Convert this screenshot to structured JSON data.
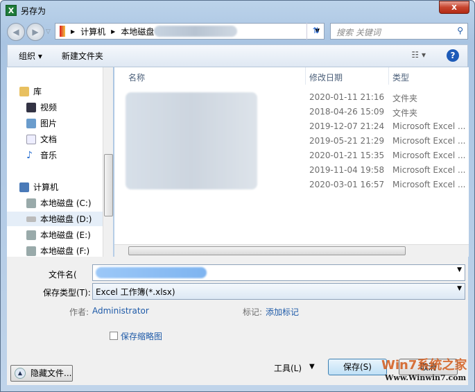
{
  "window": {
    "title": "另存为",
    "close": "x"
  },
  "address": {
    "crumbs": [
      "计算机",
      "本地磁盘"
    ],
    "search_placeholder": "搜索 关键词"
  },
  "toolbar": {
    "organize": "组织 ▾",
    "new_folder": "新建文件夹",
    "views": "☷ ▾",
    "help": "?"
  },
  "sidebar": {
    "items": [
      {
        "label": "库",
        "icon": "library-icon"
      },
      {
        "label": "视频",
        "icon": "video-icon"
      },
      {
        "label": "图片",
        "icon": "pictures-icon"
      },
      {
        "label": "文档",
        "icon": "documents-icon"
      },
      {
        "label": "音乐",
        "icon": "music-icon"
      },
      {
        "label": "计算机",
        "icon": "computer-icon"
      },
      {
        "label": "本地磁盘 (C:)",
        "icon": "drive-icon"
      },
      {
        "label": "本地磁盘 (D:)",
        "icon": "drive-icon",
        "selected": true
      },
      {
        "label": "本地磁盘 (E:)",
        "icon": "drive-icon"
      },
      {
        "label": "本地磁盘 (F:)",
        "icon": "drive-icon"
      }
    ]
  },
  "columns": {
    "name": "名称",
    "date": "修改日期",
    "type": "类型"
  },
  "files": [
    {
      "date": "2020-01-11 21:16",
      "type": "文件夹"
    },
    {
      "date": "2018-04-26 15:09",
      "type": "文件夹"
    },
    {
      "date": "2019-12-07 21:24",
      "type": "Microsoft Excel ..."
    },
    {
      "date": "2019-05-21 21:29",
      "type": "Microsoft Excel ..."
    },
    {
      "date": "2020-01-21 15:35",
      "type": "Microsoft Excel ..."
    },
    {
      "date": "2019-11-04 19:58",
      "type": "Microsoft Excel ..."
    },
    {
      "date": "2020-03-01 16:57",
      "type": "Microsoft Excel ..."
    }
  ],
  "form": {
    "filename_label": "文件名(",
    "savetype_label": "保存类型(T):",
    "savetype_value": "Excel 工作簿(*.xlsx)",
    "author_label": "作者:",
    "author_value": "Administrator",
    "tags_label": "标记:",
    "tags_value": "添加标记",
    "thumbnail_label": "保存缩略图"
  },
  "buttons": {
    "hide_folders": "隐藏文件...",
    "tools": "工具(L)",
    "save": "保存(S)",
    "cancel": "取消"
  },
  "watermark": {
    "text": "Win7系统之家",
    "url": "Www.Winwin7.com"
  }
}
